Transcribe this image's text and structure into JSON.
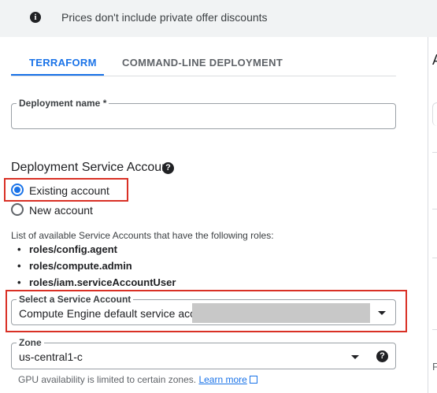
{
  "banner": {
    "text": "Prices don't include private offer discounts",
    "icon": "info-icon"
  },
  "tabs": [
    {
      "label": "TERRAFORM",
      "active": true
    },
    {
      "label": "COMMAND-LINE DEPLOYMENT",
      "active": false
    }
  ],
  "deployment_name": {
    "label": "Deployment name *",
    "value": ""
  },
  "service_account_section": {
    "title": "Deployment Service Account",
    "options": [
      {
        "label": "Existing account",
        "checked": true
      },
      {
        "label": "New account",
        "checked": false
      }
    ],
    "roles_intro": "List of available Service Accounts that have the following roles:",
    "roles": [
      "roles/config.agent",
      "roles/compute.admin",
      "roles/iam.serviceAccountUser"
    ]
  },
  "service_account_select": {
    "label": "Select a Service Account",
    "value": "Compute Engine default service account"
  },
  "zone": {
    "label": "Zone",
    "value": "us-central1-c",
    "note": "GPU availability is limited to certain zones.",
    "learn_more": "Learn more"
  },
  "right_panel": {
    "heading": "A",
    "footer_letter": "F"
  },
  "colors": {
    "accent": "#1a73e8",
    "highlight": "#d93025",
    "banner_bg": "#f1f3f4"
  }
}
